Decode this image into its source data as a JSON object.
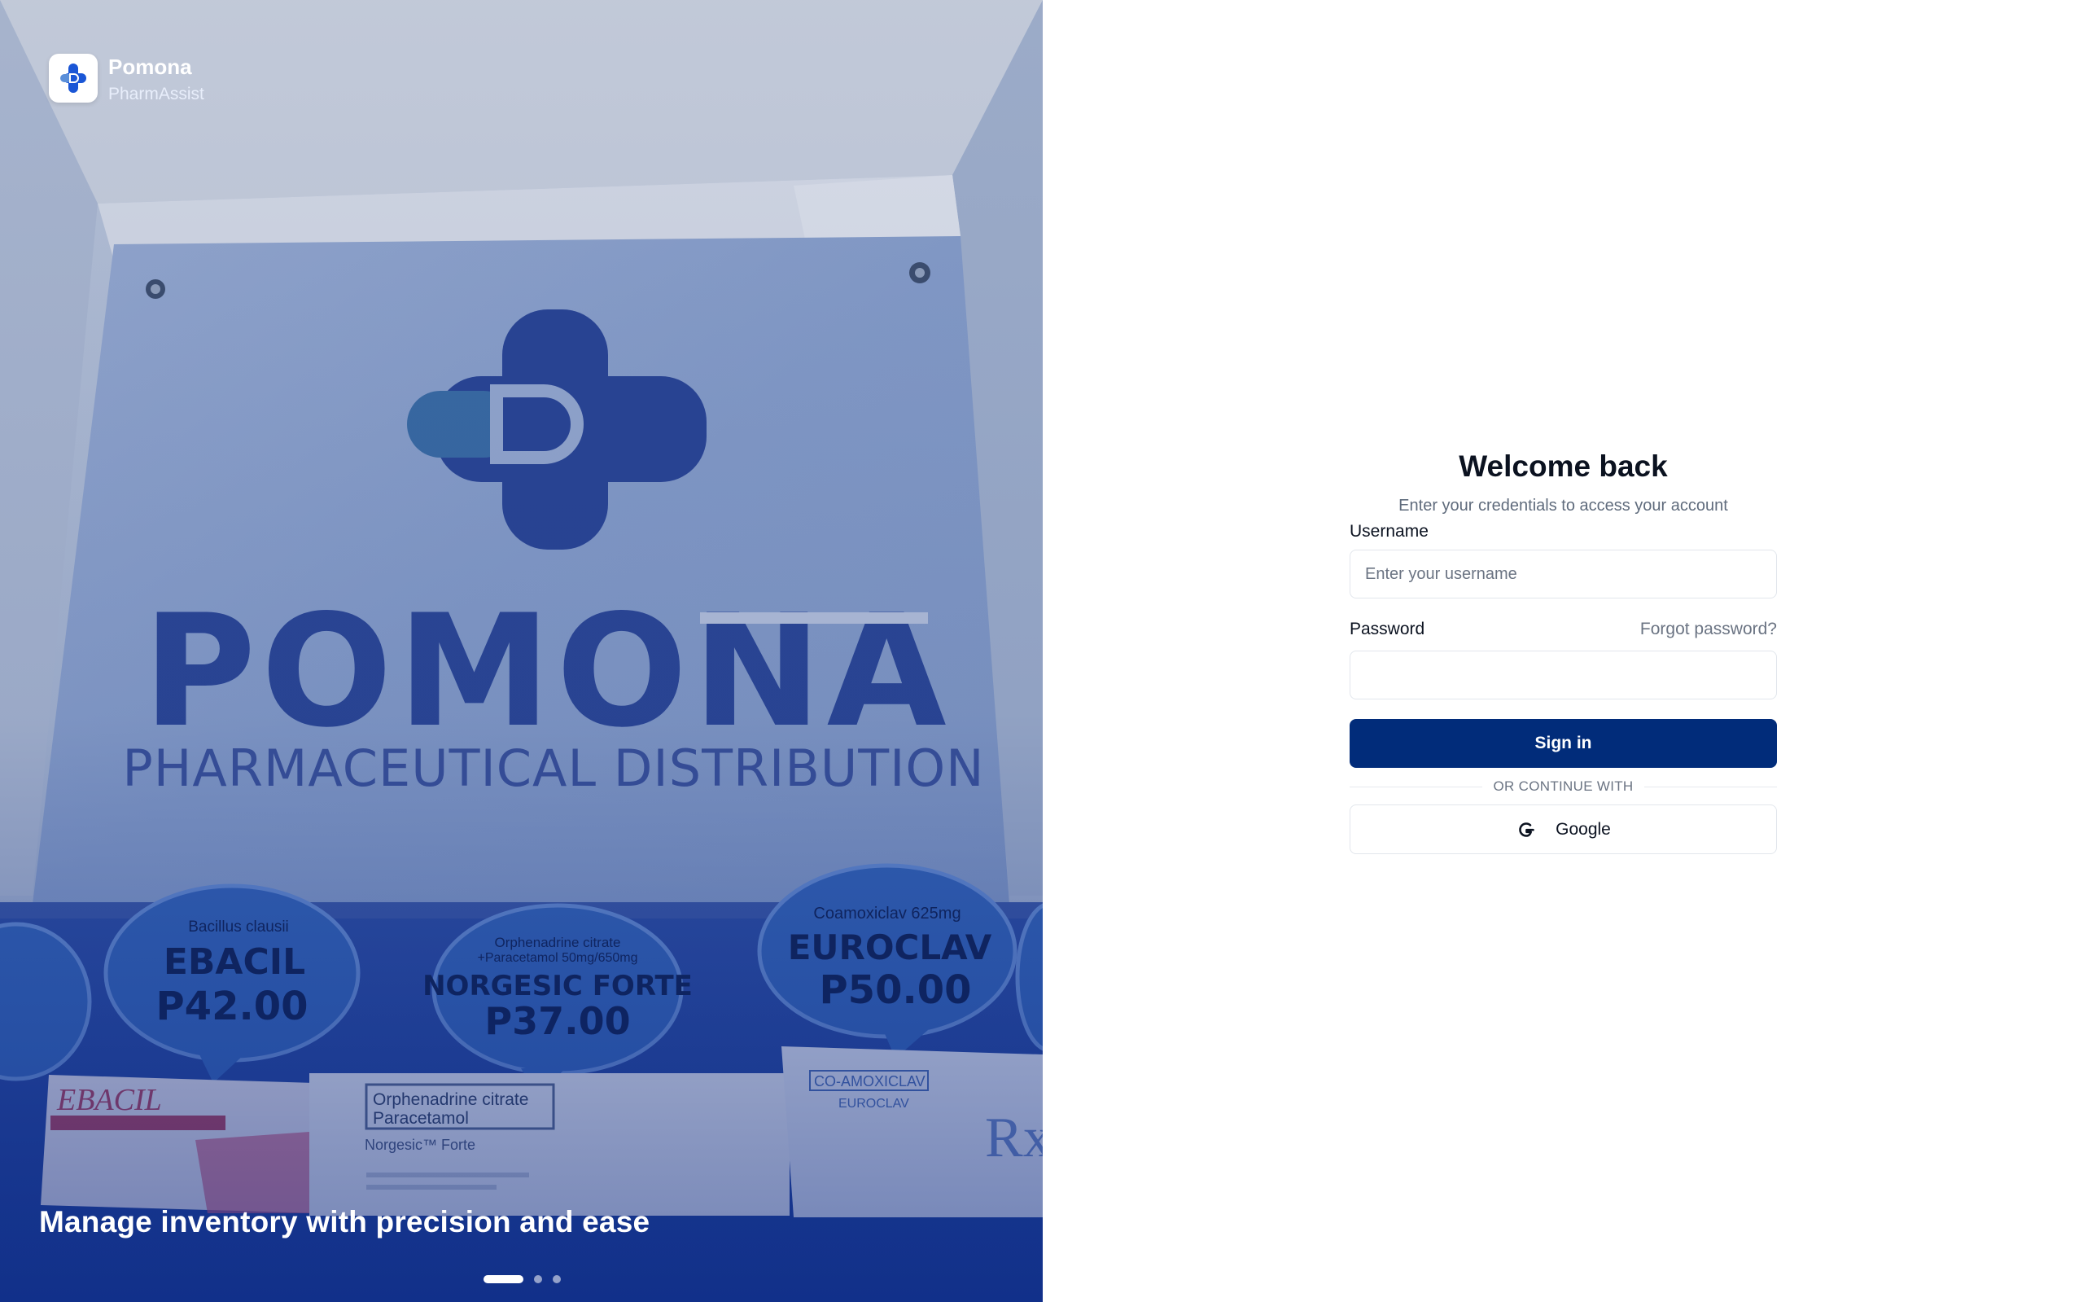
{
  "brand": {
    "name": "Pomona",
    "tagline": "PharmAssist"
  },
  "hero": {
    "caption": "Manage inventory with precision and ease",
    "slides_total": 3,
    "active_slide": 1,
    "sign": {
      "word": "POMONA",
      "subtitle": "PHARMACEUTICAL DISTRIBUTION"
    },
    "price_tags": [
      {
        "generic": "Bacillus clausii",
        "brand": "EBACIL",
        "price": "P42.00"
      },
      {
        "generic": "Orphenadrine citrate +Paracetamol 50mg/650mg",
        "brand": "NORGESIC FORTE",
        "price": "P37.00"
      },
      {
        "generic": "Coamoxiclav 625mg",
        "brand": "EUROCLAV",
        "price": "P50.00"
      }
    ]
  },
  "login": {
    "title": "Welcome back",
    "subtitle": "Enter your credentials to access your account",
    "username_label": "Username",
    "username_placeholder": "Enter your username",
    "username_value": "",
    "password_label": "Password",
    "password_value": "",
    "forgot_label": "Forgot password?",
    "signin_label": "Sign in",
    "divider_label": "OR CONTINUE WITH",
    "google_label": "Google"
  },
  "colors": {
    "primary": "#012c7a",
    "brand_blue": "#1a56d6",
    "muted_text": "#6b7483"
  }
}
